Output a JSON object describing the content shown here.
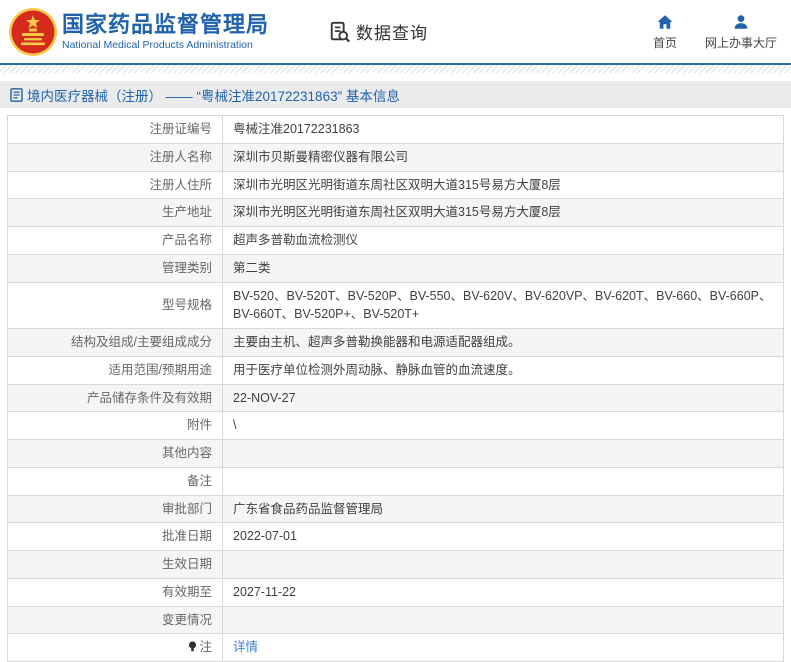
{
  "header": {
    "title": "国家药品监督管理局",
    "subtitle": "National Medical Products Administration",
    "section_label": "数据查询",
    "nav": [
      {
        "label": "首页",
        "icon": "home-icon"
      },
      {
        "label": "网上办事大厅",
        "icon": "user-icon"
      }
    ]
  },
  "breadcrumb": {
    "text": "境内医疗器械（注册） —— “粤械注准20172231863” 基本信息"
  },
  "table": {
    "rows": [
      {
        "label": "注册证编号",
        "value": "粤械注准20172231863"
      },
      {
        "label": "注册人名称",
        "value": "深圳市贝斯曼精密仪器有限公司"
      },
      {
        "label": "注册人住所",
        "value": "深圳市光明区光明街道东周社区双明大道315号易方大厦8层"
      },
      {
        "label": "生产地址",
        "value": "深圳市光明区光明街道东周社区双明大道315号易方大厦8层"
      },
      {
        "label": "产品名称",
        "value": "超声多普勒血流检测仪"
      },
      {
        "label": "管理类别",
        "value": "第二类"
      },
      {
        "label": "型号规格",
        "value": "BV-520、BV-520T、BV-520P、BV-550、BV-620V、BV-620VP、BV-620T、BV-660、BV-660P、BV-660T、BV-520P+、BV-520T+"
      },
      {
        "label": "结构及组成/主要组成成分",
        "value": "主要由主机、超声多普勒换能器和电源适配器组成。"
      },
      {
        "label": "适用范围/预期用途",
        "value": "用于医疗单位检测外周动脉、静脉血管的血流速度。"
      },
      {
        "label": "产品储存条件及有效期",
        "value": "22-NOV-27"
      },
      {
        "label": "附件",
        "value": "\\"
      },
      {
        "label": "其他内容",
        "value": ""
      },
      {
        "label": "备注",
        "value": ""
      },
      {
        "label": "审批部门",
        "value": "广东省食品药品监督管理局"
      },
      {
        "label": "批准日期",
        "value": "2022-07-01"
      },
      {
        "label": "生效日期",
        "value": ""
      },
      {
        "label": "有效期至",
        "value": "2027-11-22"
      },
      {
        "label": "变更情况",
        "value": ""
      },
      {
        "label": "注",
        "value": "详情",
        "link": true,
        "icon": "bulb-icon"
      }
    ]
  },
  "colors": {
    "brand_blue": "#2062ac",
    "rule_blue": "#2c6aa0",
    "link_blue": "#3b82d0",
    "crumb_bg": "#ebebeb",
    "zebra_bg": "#f5f5f5",
    "emblem_red": "#d52b1e",
    "emblem_gold": "#f7c948"
  }
}
